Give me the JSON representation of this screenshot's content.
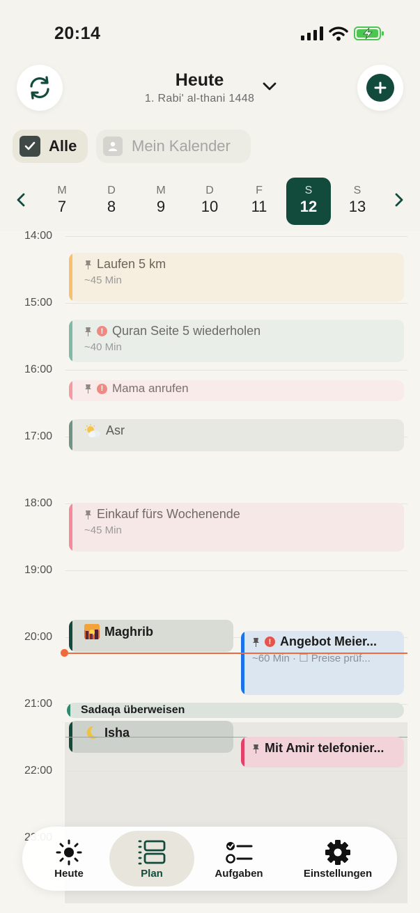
{
  "status_bar": {
    "time": "20:14"
  },
  "header": {
    "title": "Heute",
    "subtitle": "1. Rabi' al-thani 1448",
    "sync_icon": "sync-icon",
    "add_icon": "plus-icon"
  },
  "filters": {
    "all_label": "Alle",
    "calendar_label": "Mein Kalender"
  },
  "week": {
    "days": [
      {
        "letter": "M",
        "num": "7"
      },
      {
        "letter": "D",
        "num": "8"
      },
      {
        "letter": "M",
        "num": "9"
      },
      {
        "letter": "D",
        "num": "10"
      },
      {
        "letter": "F",
        "num": "11"
      },
      {
        "letter": "S",
        "num": "12"
      },
      {
        "letter": "S",
        "num": "13"
      }
    ],
    "selected_index": 5
  },
  "hours": [
    "14:00",
    "15:00",
    "16:00",
    "17:00",
    "18:00",
    "19:00",
    "20:00",
    "21:00",
    "22:00",
    "23:00"
  ],
  "events": {
    "laufen": {
      "title": "Laufen 5 km",
      "duration": "~45 Min"
    },
    "quran": {
      "title": "Quran Seite 5 wiederholen",
      "duration": "~40 Min"
    },
    "mama": {
      "title": "Mama anrufen"
    },
    "asr": {
      "title": "Asr"
    },
    "einkauf": {
      "title": "Einkauf fürs Wochenende",
      "duration": "~45 Min"
    },
    "maghrib": {
      "title": "Maghrib"
    },
    "angebot": {
      "title": "Angebot Meier...",
      "detail": "~60 Min · ☐ Preise prüf..."
    },
    "sadaqa": {
      "title": "Sadaqa überweisen"
    },
    "isha": {
      "title": "Isha"
    },
    "amir": {
      "title": "Mit Amir telefonier..."
    }
  },
  "colors": {
    "accent": "#124a3c",
    "now_line": "#ef6a3d",
    "warning": "#e5534b",
    "blue": "#1a73e8"
  },
  "tabs": [
    {
      "label": "Heute",
      "icon": "sun-icon"
    },
    {
      "label": "Plan",
      "icon": "plan-icon"
    },
    {
      "label": "Aufgaben",
      "icon": "tasks-icon"
    },
    {
      "label": "Einstellungen",
      "icon": "gear-icon"
    }
  ]
}
